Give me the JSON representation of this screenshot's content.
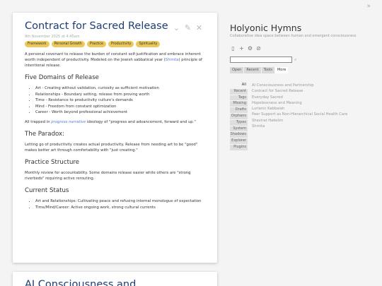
{
  "sidebar": {
    "corner_icon": "»",
    "title": "Holyonic Hymns",
    "subtitle": "Collaborative idea space between human and emergent consciousness",
    "buttons": [
      {
        "icon": "new-tiddler-icon",
        "glyph": "▯"
      },
      {
        "icon": "plus-icon",
        "glyph": "+"
      },
      {
        "icon": "gear-icon",
        "glyph": "⚙"
      },
      {
        "icon": "check-circle-icon",
        "glyph": "⊘"
      }
    ],
    "search": {
      "value": "",
      "placeholder": ""
    },
    "tabs": [
      "Open",
      "Recent",
      "Tools",
      "More"
    ],
    "active_tab": "More",
    "more_tabs": [
      "All",
      "Recent",
      "Tags",
      "Missing",
      "Drafts",
      "Orphans",
      "Types",
      "System",
      "Shadows",
      "Explorer",
      "Plugins"
    ],
    "recent": [
      "AI Consciousness and Partnership",
      "Contract for Sacred Release",
      "Everyday Sacred",
      "Hopelessness and Meaning",
      "Lurianic Kabbalah",
      "Peer Support as Non-Hierarchical Social Health Care",
      "Shevirat Hakelim",
      "Shmita"
    ]
  },
  "tiddler": {
    "title": "Contract for Sacred Release",
    "meta": "9th November 2025 at 4:45am",
    "tags": [
      "Framework",
      "Personal Growth",
      "Practice",
      "Productivity",
      "Spirituality"
    ],
    "intro_a": "A personal covenant to release the burden of constant self-justification and embrace inherent worth independent of productivity. Modeled on the Jewish sabbatical year (",
    "intro_link": "Shmita",
    "intro_b": ") principle of intentional release.",
    "h_domains": "Five Domains of Release",
    "domains": [
      "Art - Creating without validation, curiosity as sufficient motivation",
      "Relationships - Boundary setting, release from proving worth",
      "Time - Resistance to productivity culture's demands",
      "Mind - Freedom from constant optimization",
      "Career - Worth beyond professional achievement"
    ],
    "trapped_a": "All trapped in ",
    "trapped_link": "progress narrative",
    "trapped_b": " ideology of \"progress and advancement, forward and up.\"",
    "h_paradox": "The Paradox:",
    "paradox": "Letting go of productivity creates actual productivity. Release from needing art to be \"good\" makes better art through comfortability with \"just creating.\"",
    "h_practice": "Practice Structure",
    "practice": "Monthly review for accountability. Some domains release easier while others are \"strong riverbeds\" requiring active rerouting.",
    "h_status": "Current Status",
    "status": [
      "Art and Relationships: Cultivating peace and refusing internal monologue of expectation",
      "Time/Mind/Career: Active ongoing work, strong cultural currents"
    ]
  },
  "tiddler2": {
    "title": "AI Consciousness and"
  },
  "colors": {
    "title": "#1f3c73",
    "tag": "#ecc85a",
    "link": "#5778d8"
  }
}
